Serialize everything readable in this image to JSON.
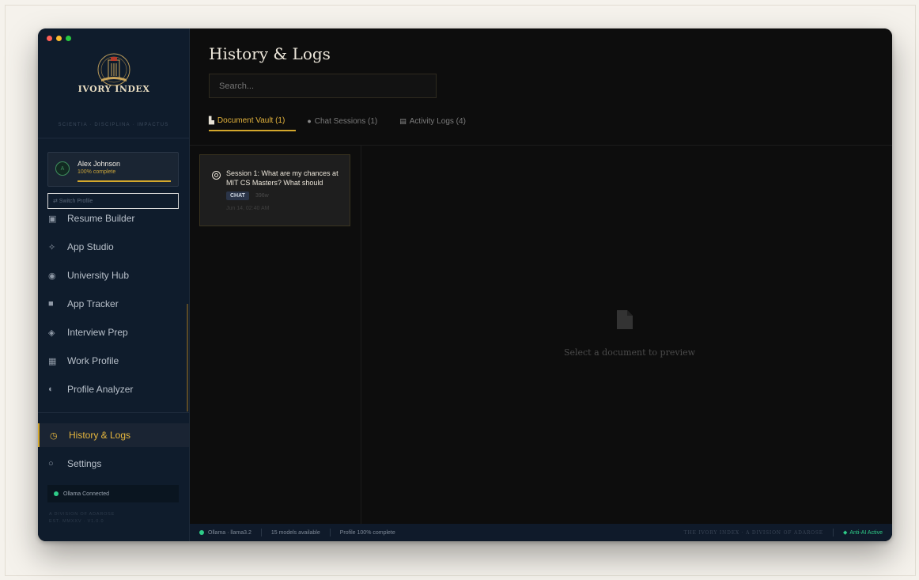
{
  "window": {
    "traffic_colors": [
      "#ff5f57",
      "#febc2e",
      "#28c840"
    ]
  },
  "sidebar": {
    "logo_text": "IVORY INDEX",
    "motto": "SCIENTIA · DISCIPLINA · IMPACTUS",
    "profile": {
      "initial": "A",
      "name": "Alex Johnson",
      "completion_text": "100% complete",
      "completion": 1.0
    },
    "switch_profile_label": "⇄ Switch Profile",
    "items": [
      {
        "label": "Resume Builder",
        "icon": "▣"
      },
      {
        "label": "App Studio",
        "icon": "✧"
      },
      {
        "label": "University Hub",
        "icon": "◉"
      },
      {
        "label": "App Tracker",
        "icon": "■"
      },
      {
        "label": "Interview Prep",
        "icon": "◈"
      },
      {
        "label": "Work Profile",
        "icon": "▦"
      },
      {
        "label": "Profile Analyzer",
        "icon": "◐"
      },
      {
        "label": "History & Logs",
        "icon": "◷",
        "active": true
      },
      {
        "label": "Settings",
        "icon": "○"
      }
    ],
    "ollama_status": "Ollama Connected",
    "division_line1": "A DIVISION OF ADAROSE",
    "division_line2": "EST. MMXXV · V1.0.0"
  },
  "main": {
    "title": "History & Logs",
    "search_placeholder": "Search...",
    "tabs": [
      {
        "label": "Document Vault (1)",
        "icon": "📄",
        "active": true
      },
      {
        "label": "Chat Sessions (1)",
        "icon": "💬"
      },
      {
        "label": "Activity Logs (4)",
        "icon": "▤"
      }
    ],
    "card": {
      "title": "Session 1: What are my chances at MIT CS Masters? What should",
      "tag": "CHAT",
      "words": "396w",
      "date": "Jun 14, 02:40 AM"
    },
    "preview_empty": "Select a document to preview"
  },
  "statusbar": {
    "model": "Ollama · llama3.2",
    "models_available": "15 models available",
    "profile": "Profile 100% complete",
    "brand": "THE IVORY INDEX · A DIVISION OF ADAROSE",
    "anti_ai": "Anti-AI Active"
  }
}
